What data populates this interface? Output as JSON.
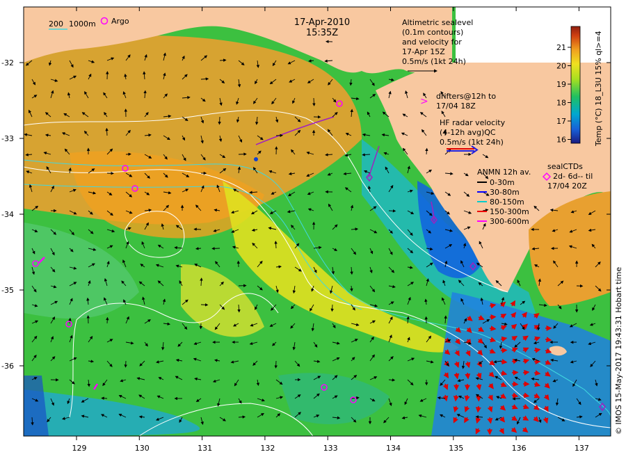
{
  "title": {
    "date": "17-Apr-2010",
    "time": "15:35Z"
  },
  "scale_bar": {
    "label_a": "200",
    "label_b": "1000m"
  },
  "argo_legend": {
    "label": "Argo"
  },
  "altimetry_note": {
    "lines": [
      "Altimetric sealevel",
      "(0.1m contours)",
      "and velocity for",
      "17-Apr 15Z",
      "0.5m/s (1kt 24h)"
    ]
  },
  "drifters_note": {
    "lines": [
      "drifters@12h to",
      "17/04 18Z"
    ]
  },
  "hf_radar_note": {
    "lines": [
      "HF radar velocity",
      "(4-12h avg)QC",
      "0.5m/s (1kt 24h)"
    ]
  },
  "anmn_legend": {
    "title": "ANMN 12h av.",
    "items": [
      {
        "label": "0-30m",
        "color": "#000000"
      },
      {
        "label": "30-80m",
        "color": "#0000ff"
      },
      {
        "label": "80-150m",
        "color": "#00cccc"
      },
      {
        "label": "150-300m",
        "color": "#ee0000"
      },
      {
        "label": "300-600m",
        "color": "#ff00ff"
      }
    ]
  },
  "sealctd_legend": {
    "lines": [
      "sealCTDs",
      "2d- 6d-- til",
      "17/04 20Z"
    ]
  },
  "colorbar": {
    "label": "Temp (°C) 18_L3U 15% ql>=4",
    "ticks": [
      "21",
      "20",
      "19",
      "18",
      "17",
      "16"
    ],
    "stops": [
      "#1a1a80",
      "#1860d8",
      "#00a8d0",
      "#20c060",
      "#a8e020",
      "#f0e020",
      "#f0a020",
      "#d04010",
      "#902010"
    ]
  },
  "axes": {
    "x_ticks": [
      "129",
      "130",
      "131",
      "132",
      "133",
      "134",
      "135",
      "136",
      "137"
    ],
    "y_ticks": [
      "-32",
      "-33",
      "-34",
      "-35",
      "-36"
    ]
  },
  "credit": "© IMOS 15-May-2017 19:43:31 Hobart time",
  "colors": {
    "land": "#f8c8a0",
    "ocean_green": "#3cc040",
    "ocean_yellow": "#e0e020",
    "ocean_orange": "#e8a030",
    "ocean_blue": "#1070e0"
  }
}
